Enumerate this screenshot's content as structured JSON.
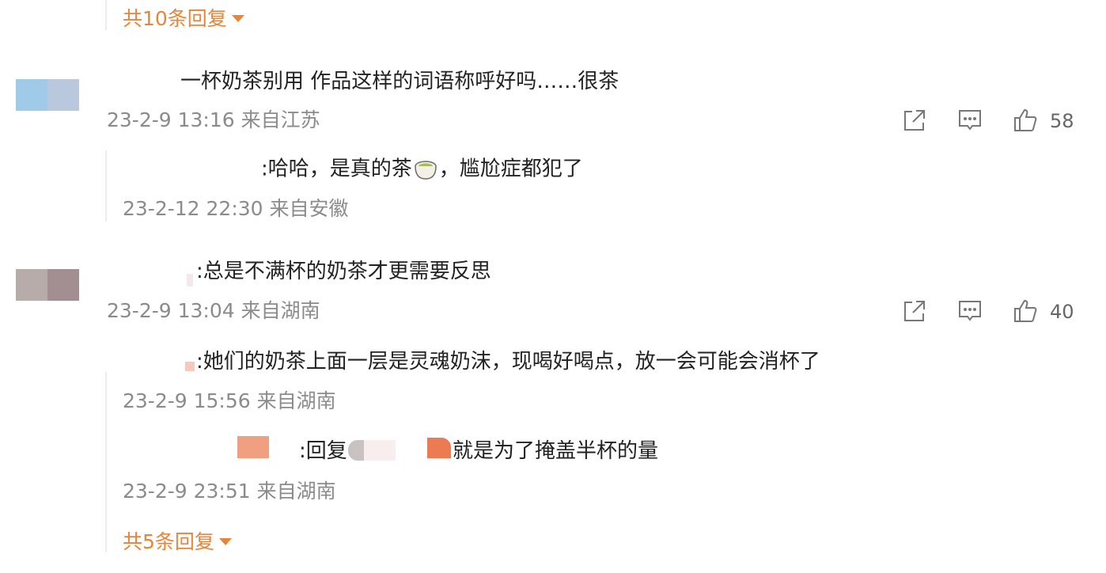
{
  "top_replies": {
    "label": "共10条回复"
  },
  "comments": [
    {
      "text": "一杯奶茶别用 作品这样的词语称呼好吗……很茶",
      "time": "23-2-9 13:16",
      "location": "来自江苏",
      "likes": "58"
    },
    {
      "text": ":总是不满杯的奶茶才更需要反思",
      "time": "23-2-9 13:04",
      "location": "来自湖南",
      "likes": "40"
    }
  ],
  "replies": [
    {
      "text_before": ":哈哈，是真的茶",
      "emoji": "tea-emoji",
      "text_after": "，尴尬症都犯了",
      "time": "23-2-12 22:30",
      "location": "来自安徽"
    },
    {
      "text": ":她们的奶茶上面一层是灵魂奶沫，现喝好喝点，放一会可能会消杯了",
      "time": "23-2-9 15:56",
      "location": "来自湖南"
    },
    {
      "prefix": ":回复",
      "text": "就是为了掩盖半杯的量",
      "time": "23-2-9 23:51",
      "location": "来自湖南"
    }
  ],
  "bottom_replies": {
    "label": "共5条回复"
  },
  "icons": {
    "share": "share-icon",
    "comment": "comment-icon",
    "like": "like-icon"
  },
  "colors": {
    "accent": "#e7863a",
    "meta": "#8b8b8b",
    "text": "#222222"
  }
}
